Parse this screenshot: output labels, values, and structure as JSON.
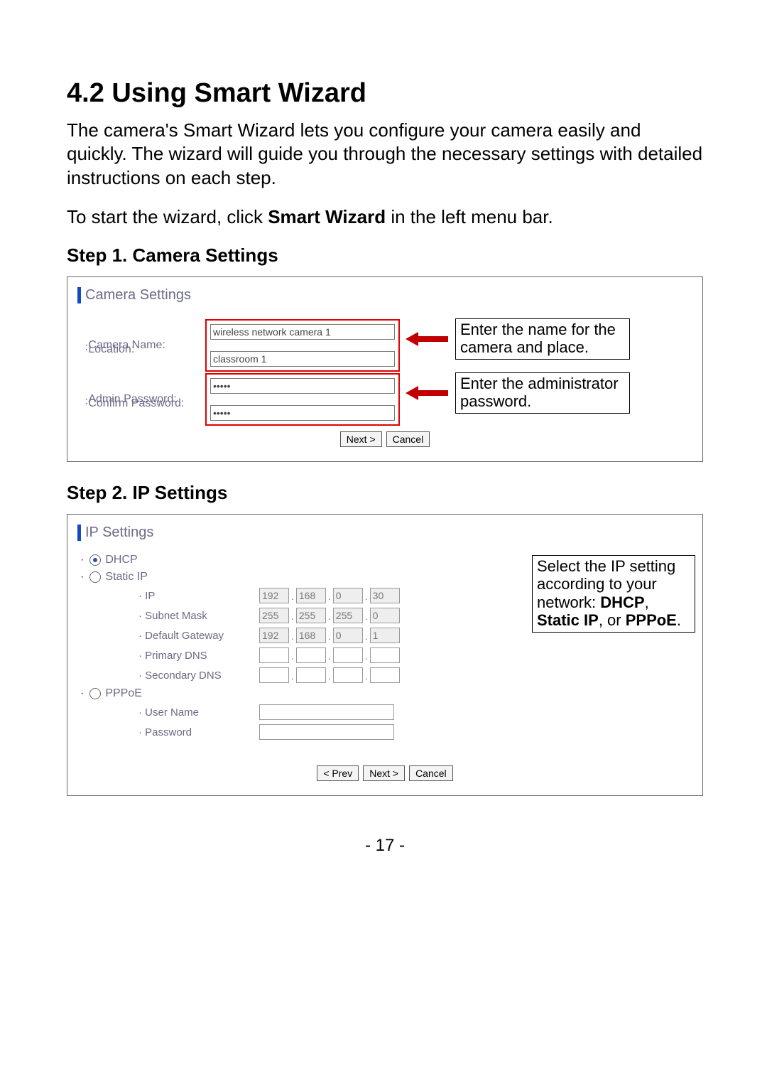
{
  "header": {
    "title": "4.2  Using Smart Wizard",
    "para1": "The camera's Smart Wizard lets you configure your camera easily and quickly. The wizard will guide you through the necessary settings with detailed instructions on each step.",
    "para2_pre": "To start the wizard, click ",
    "para2_bold": "Smart Wizard",
    "para2_post": " in the left menu bar."
  },
  "step1": {
    "heading": "Step 1. Camera Settings",
    "panel_title": "Camera Settings",
    "labels": {
      "camera_name": "·Camera Name:",
      "location": "·Location:",
      "admin_pw": "·Admin Password:",
      "confirm_pw": "·Confirm Password:"
    },
    "values": {
      "camera_name": "wireless network camera 1",
      "location": "classroom 1",
      "admin_pw": "•••••",
      "confirm_pw": "•••••"
    },
    "note1": "Enter the name for the camera and place.",
    "note2": "Enter the administrator password.",
    "buttons": {
      "next": "Next >",
      "cancel": "Cancel"
    }
  },
  "step2": {
    "heading": "Step 2. IP Settings",
    "panel_title": "IP Settings",
    "radios": {
      "dhcp": "DHCP",
      "static": "Static IP",
      "pppoe": "PPPoE"
    },
    "labels": {
      "ip": "· IP",
      "subnet": "· Subnet Mask",
      "gateway": "· Default Gateway",
      "pdns": "· Primary DNS",
      "sdns": "· Secondary DNS",
      "user": "· User Name",
      "pass": "· Password"
    },
    "ip": [
      "192",
      "168",
      "0",
      "30"
    ],
    "subnet": [
      "255",
      "255",
      "255",
      "0"
    ],
    "gateway": [
      "192",
      "168",
      "0",
      "1"
    ],
    "note_pre": "Select the IP setting according to your network: ",
    "note_b1": "DHCP",
    "note_mid1": ", ",
    "note_b2": "Static IP",
    "note_mid2": ", or ",
    "note_b3": "PPPoE",
    "note_post": ".",
    "buttons": {
      "prev": "< Prev",
      "next": "Next >",
      "cancel": "Cancel"
    }
  },
  "footer": {
    "page": "- 17 -"
  }
}
